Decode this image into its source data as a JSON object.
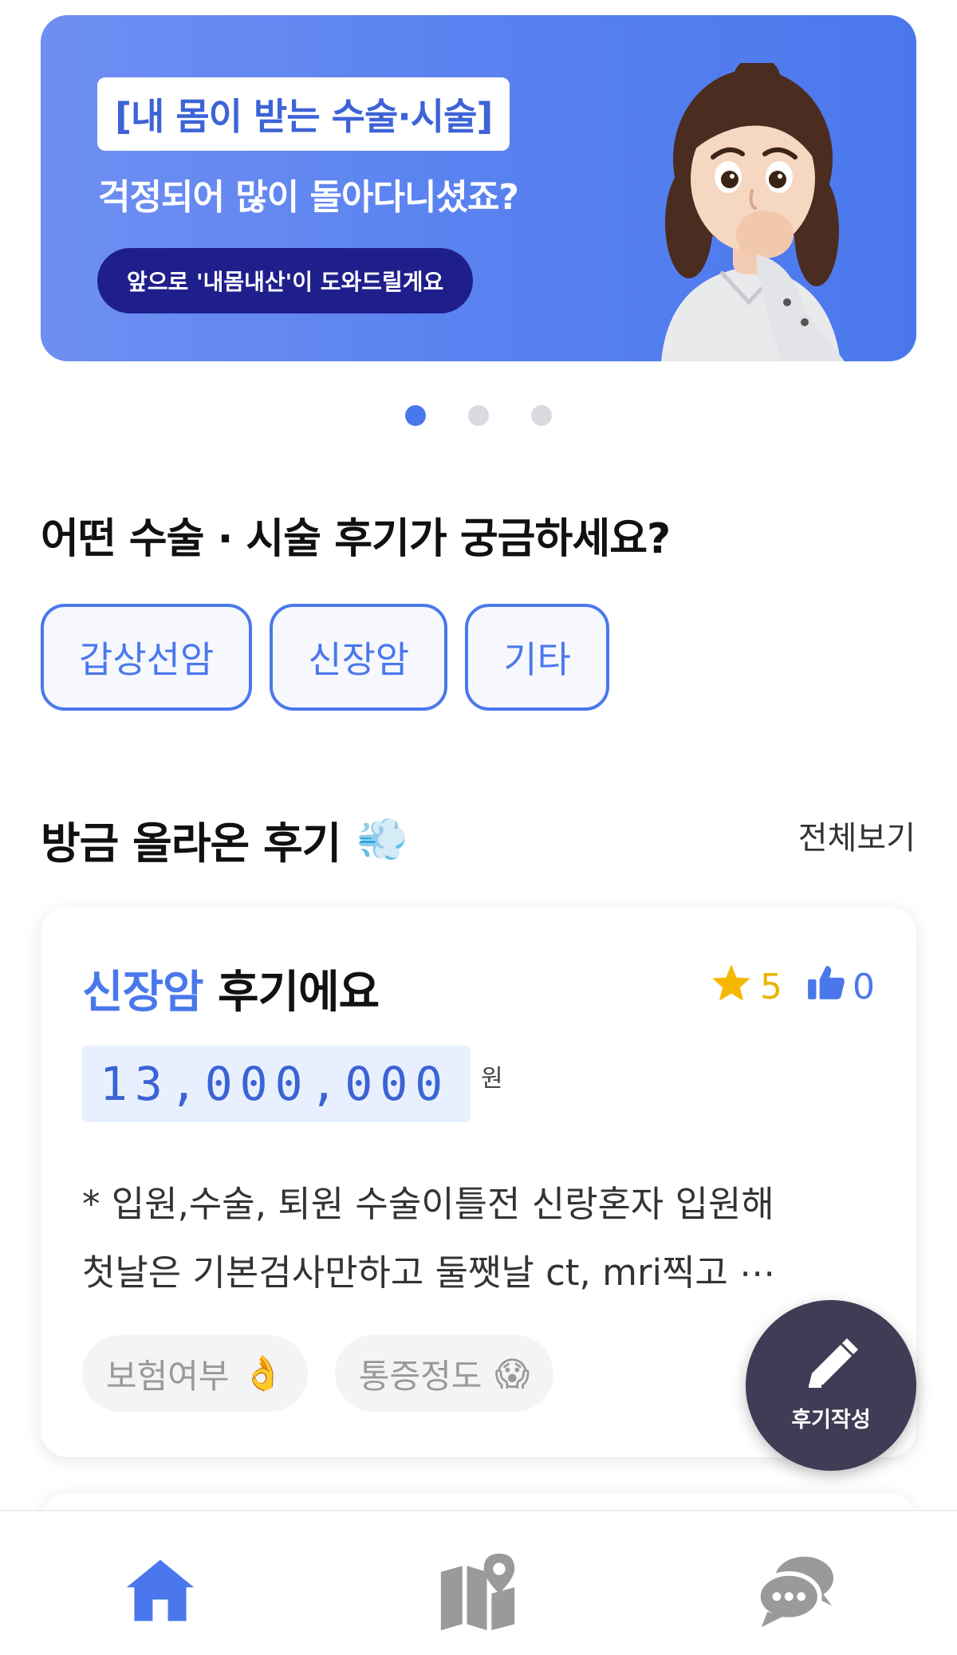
{
  "banner": {
    "tag": "[내 몸이 받는 수술·시술]",
    "subtitle": "걱정되어 많이 돌아다니셨죠?",
    "cta": "앞으로 '내몸내산'이 도와드릴게요",
    "slide_count": 3,
    "active_slide": 1
  },
  "categories": {
    "question": "어떤 수술 · 시술 후기가 궁금하세요?",
    "chips": [
      "갑상선암",
      "신장암",
      "기타"
    ]
  },
  "recent": {
    "title": "방금 올라온 후기",
    "title_emoji": "💨",
    "see_all": "전체보기"
  },
  "review": {
    "category": "신장암",
    "title_suffix": " 후기에요",
    "rating": "5",
    "likes": "0",
    "price": "13,000,000",
    "price_unit": "원",
    "excerpt_line1": "* 입원,수술, 퇴원 수술이틀전 신랑혼자 입원해",
    "excerpt_line2": "첫날은 기본검사만하고 둘쨋날 ct, mri찍고 ⋯",
    "badges": [
      {
        "label": "보험여부",
        "emoji": "👌"
      },
      {
        "label": "통증정도",
        "emoji": "😱"
      }
    ]
  },
  "fab": {
    "label": "후기작성",
    "icon": "pencil-icon"
  },
  "nav": {
    "items": [
      {
        "icon": "home-icon",
        "active": true
      },
      {
        "icon": "map-icon",
        "active": false
      },
      {
        "icon": "chat-icon",
        "active": false
      }
    ]
  },
  "colors": {
    "accent": "#4a78ec",
    "cta_bg": "#1f1f8c",
    "fab_bg": "#3f3d55",
    "star": "#f5b800",
    "inactive_icon": "#9a9a9a"
  }
}
